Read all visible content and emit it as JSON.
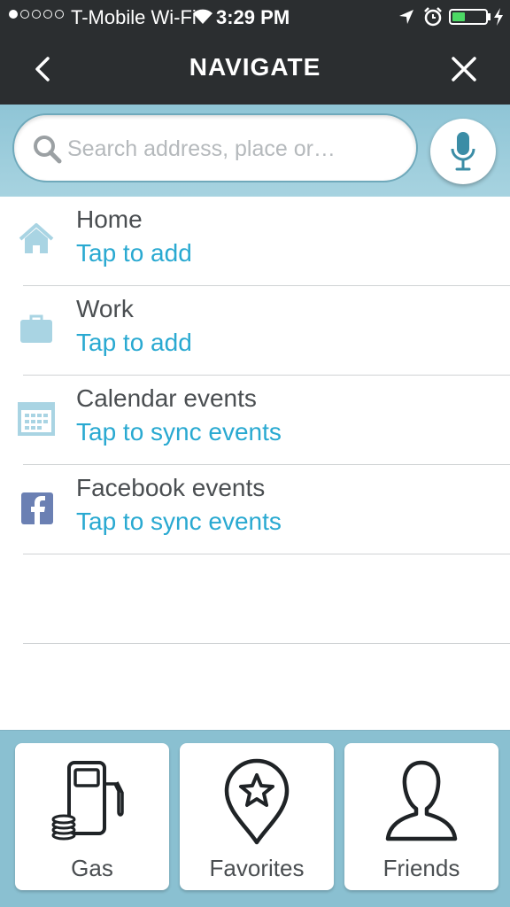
{
  "status_bar": {
    "carrier": "T-Mobile Wi-Fi",
    "time": "3:29 PM",
    "signal_bars_filled": 1,
    "signal_bars_total": 5,
    "battery_level": 0.4,
    "battery_color": "#4cd964"
  },
  "header": {
    "title": "NAVIGATE",
    "back_icon": "chevron-left-icon",
    "close_icon": "close-icon"
  },
  "search": {
    "placeholder": "Search address, place or…",
    "value": "",
    "mic_icon": "microphone-icon"
  },
  "list": {
    "items": [
      {
        "title": "Home",
        "subtitle": "Tap to add",
        "icon": "home-icon"
      },
      {
        "title": "Work",
        "subtitle": "Tap to add",
        "icon": "briefcase-icon"
      },
      {
        "title": "Calendar events",
        "subtitle": "Tap to sync events",
        "icon": "calendar-icon"
      },
      {
        "title": "Facebook events",
        "subtitle": "Tap to sync events",
        "icon": "facebook-icon"
      }
    ]
  },
  "bottom": {
    "tiles": [
      {
        "label": "Gas",
        "icon": "gas-pump-icon"
      },
      {
        "label": "Favorites",
        "icon": "star-pin-icon"
      },
      {
        "label": "Friends",
        "icon": "person-icon"
      }
    ]
  },
  "colors": {
    "header_bg": "#2b2e30",
    "accent": "#29a9d1",
    "band_bg": "#8ac0d1"
  }
}
